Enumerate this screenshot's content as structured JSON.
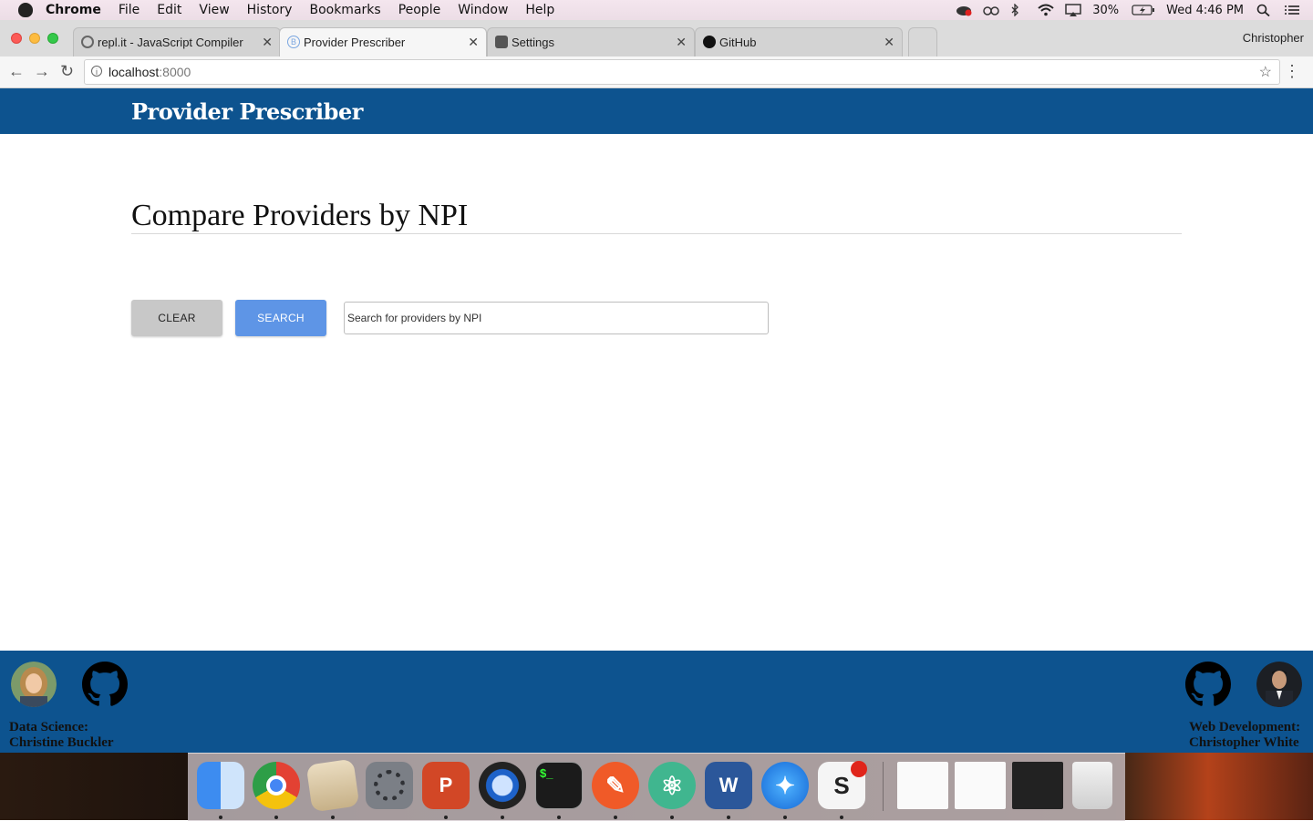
{
  "menubar": {
    "app": "Chrome",
    "items": [
      "File",
      "Edit",
      "View",
      "History",
      "Bookmarks",
      "People",
      "Window",
      "Help"
    ],
    "battery": "30%",
    "clock": "Wed 4:46 PM"
  },
  "tabs": [
    {
      "title": "repl.it - JavaScript Compiler"
    },
    {
      "title": "Provider Prescriber"
    },
    {
      "title": "Settings"
    },
    {
      "title": "GitHub"
    }
  ],
  "profile": "Christopher",
  "omnibox": {
    "host": "localhost",
    "port": ":8000"
  },
  "app": {
    "brand": "Provider Prescriber",
    "heading": "Compare Providers by NPI",
    "clear_label": "CLEAR",
    "search_label": "SEARCH",
    "search_placeholder": "Search for providers by NPI",
    "search_value": ""
  },
  "footer": {
    "left_role": "Data Science:",
    "left_name": "Christine Buckler",
    "right_role": "Web Development:",
    "right_name": "Christopher White"
  },
  "colors": {
    "brand_blue": "#0d538f",
    "search_blue": "#5e95e6",
    "clear_grey": "#c8c8c8"
  },
  "dock": [
    "finder-icon",
    "chrome-icon",
    "mail-icon",
    "system-preferences-icon",
    "powerpoint-icon",
    "quicktime-icon",
    "terminal-icon",
    "pencil-app-icon",
    "atom-icon",
    "word-icon",
    "safari-icon",
    "slack-icon",
    "powerpoint-window-icon",
    "word-window-icon",
    "terminal-window-icon",
    "trash-icon"
  ]
}
